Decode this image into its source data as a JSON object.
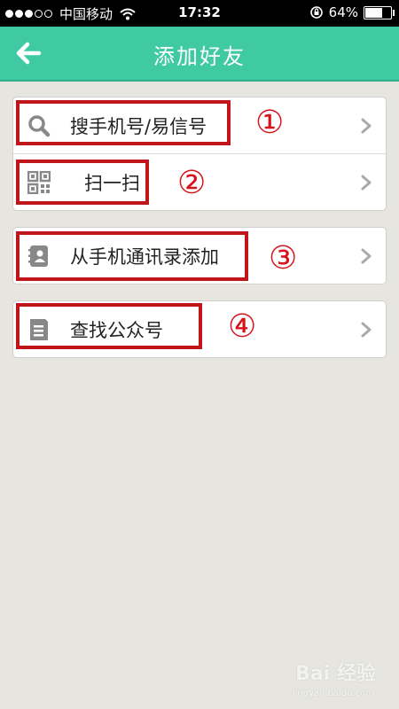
{
  "status_bar": {
    "carrier": "中国移动",
    "time": "17:32",
    "battery_text": "64%",
    "battery_level": 0.64
  },
  "header": {
    "title": "添加好友"
  },
  "menu": {
    "search": {
      "label": "搜手机号/易信号",
      "annotation": "①",
      "icon": "search-icon"
    },
    "scan": {
      "label": "扫一扫",
      "annotation": "②",
      "icon": "qr-code-icon"
    },
    "contacts": {
      "label": "从手机通讯录添加",
      "annotation": "③",
      "icon": "contacts-book-icon"
    },
    "public": {
      "label": "查找公众号",
      "annotation": "④",
      "icon": "public-account-icon"
    }
  },
  "watermark": {
    "text": "Bai 经验",
    "sub": "jingyan.baidu.com"
  },
  "colors": {
    "header": "#3fcaa3",
    "highlight": "#c0151b",
    "annotation": "#d8121b",
    "background": "#e6e5e0"
  }
}
